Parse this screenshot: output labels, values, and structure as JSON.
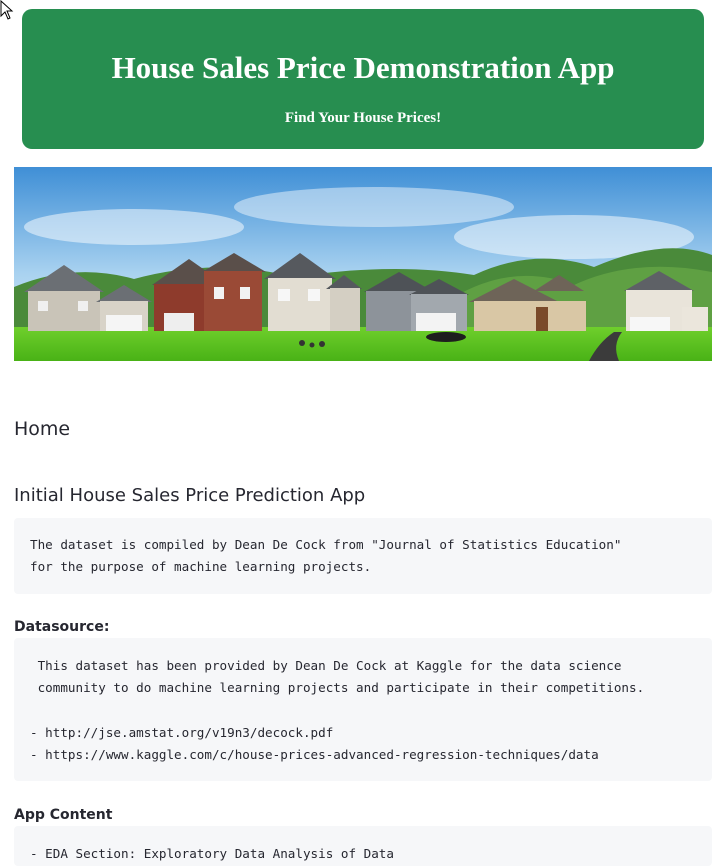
{
  "header": {
    "title": "House Sales Price Demonstration App",
    "subtitle": "Find Your House Prices!",
    "color": "#278e50"
  },
  "hero_image": {
    "icon": "houses-street-image"
  },
  "sections": {
    "home_heading": "Home",
    "app_heading": "Initial House Sales Price Prediction App",
    "description_lines": [
      "The dataset is compiled by Dean De Cock from \"Journal of Statistics Education\"",
      "for the purpose of machine learning projects."
    ],
    "datasource_label": "Datasource:",
    "datasource_lines": [
      " This dataset has been provided by Dean De Cock at Kaggle for the data science",
      " community to do machine learning projects and participate in their competitions."
    ],
    "datasource_links": [
      "- http://jse.amstat.org/v19n3/decock.pdf",
      "- https://www.kaggle.com/c/house-prices-advanced-regression-techniques/data"
    ],
    "app_content_label": "App Content",
    "app_content_lines": [
      "- EDA Section: Exploratory Data Analysis of Data"
    ]
  }
}
